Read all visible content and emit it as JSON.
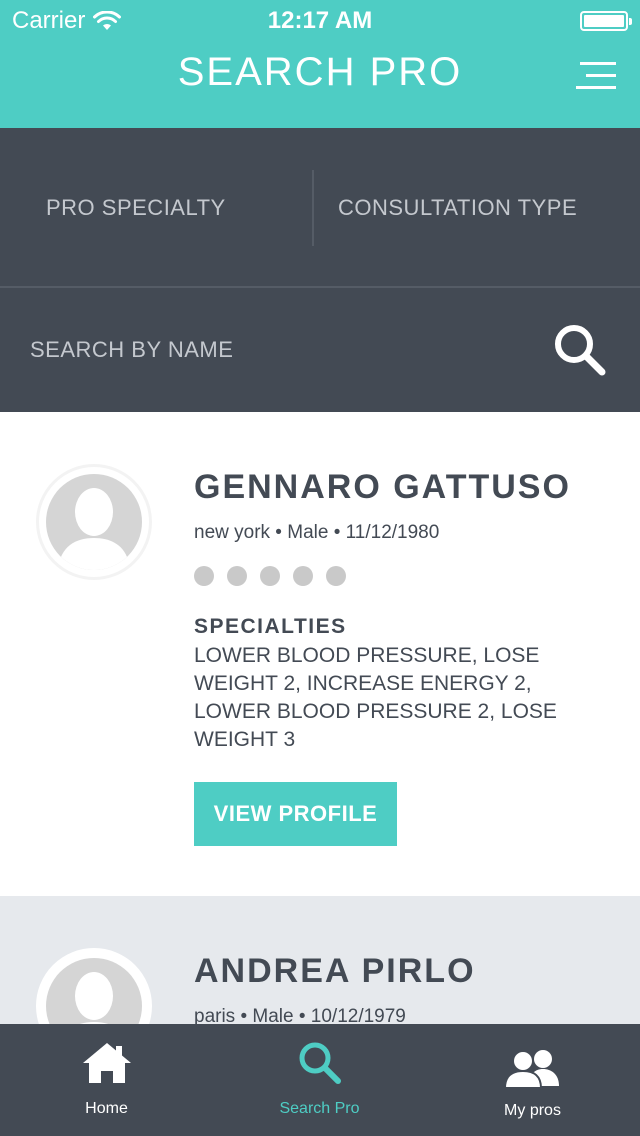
{
  "status_bar": {
    "carrier": "Carrier",
    "time": "12:17 AM"
  },
  "header": {
    "title": "SEARCH PRO",
    "menu_icon": "hamburger-menu-icon"
  },
  "filters": {
    "specialty_label": "PRO SPECIALTY",
    "consultation_label": "CONSULTATION TYPE",
    "search_placeholder": "SEARCH BY NAME",
    "search_icon": "search-icon"
  },
  "pros": [
    {
      "name": "GENNARO GATTUSO",
      "meta": "new york • Male • 11/12/1980",
      "rating": 0,
      "rating_max": 5,
      "specialties_label": "SPECIALTIES",
      "specialties": "LOWER BLOOD PRESSURE, LOSE WEIGHT 2, INCREASE ENERGY 2, LOWER BLOOD PRESSURE 2, LOSE WEIGHT 3",
      "view_label": "VIEW PROFILE"
    },
    {
      "name": "ANDREA PIRLO",
      "meta": "paris • Male • 10/12/1979"
    }
  ],
  "tabbar": {
    "tabs": [
      {
        "label": "Home",
        "icon": "home-icon"
      },
      {
        "label": "Search Pro",
        "icon": "search-icon",
        "active": true
      },
      {
        "label": "My pros",
        "icon": "users-icon"
      }
    ]
  },
  "colors": {
    "accent": "#4ecdc4",
    "dark": "#434a54",
    "muted": "#c4c8ce",
    "card_alt": "#e6e9ed"
  }
}
